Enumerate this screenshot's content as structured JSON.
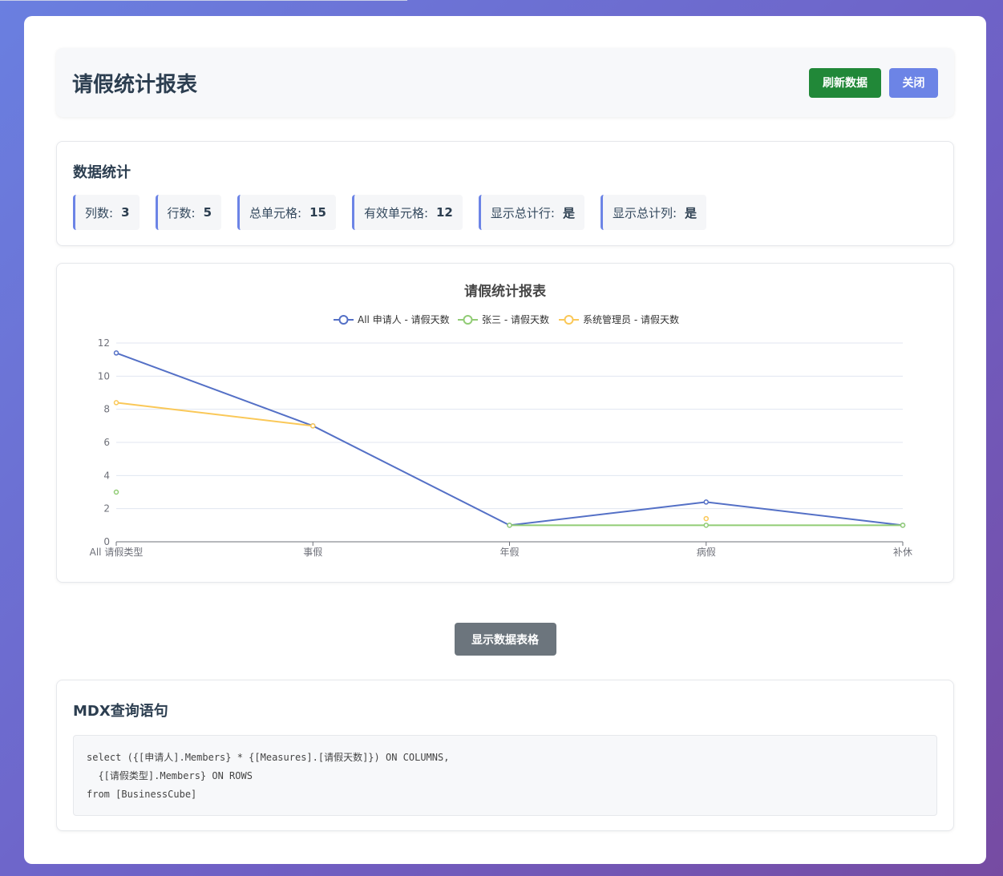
{
  "header": {
    "title": "请假统计报表",
    "refresh_label": "刷新数据",
    "close_label": "关闭"
  },
  "stats": {
    "title": "数据统计",
    "items": [
      {
        "label": "列数:",
        "value": "3"
      },
      {
        "label": "行数:",
        "value": "5"
      },
      {
        "label": "总单元格:",
        "value": "15"
      },
      {
        "label": "有效单元格:",
        "value": "12"
      },
      {
        "label": "显示总计行:",
        "value": "是"
      },
      {
        "label": "显示总计列:",
        "value": "是"
      }
    ]
  },
  "colors": {
    "accent": "#6c84e6",
    "refresh": "#218838",
    "toggle": "#6c757d"
  },
  "chart_data": {
    "type": "line",
    "title": "请假统计报表",
    "categories": [
      "All 请假类型",
      "事假",
      "年假",
      "病假",
      "补休"
    ],
    "ylim": [
      0,
      12
    ],
    "yticks": [
      0,
      2,
      4,
      6,
      8,
      10,
      12
    ],
    "grid": true,
    "legend_position": "top",
    "series": [
      {
        "name": "All 申请人 - 请假天数",
        "color": "#5470c6",
        "values": [
          11.4,
          7,
          1,
          2.4,
          1
        ]
      },
      {
        "name": "张三 - 请假天数",
        "color": "#91cc75",
        "values": [
          3,
          null,
          1,
          1,
          1
        ]
      },
      {
        "name": "系统管理员 - 请假天数",
        "color": "#fac858",
        "values": [
          8.4,
          7,
          null,
          1.4,
          null
        ]
      }
    ]
  },
  "toggle": {
    "label": "显示数据表格"
  },
  "mdx": {
    "title": "MDX查询语句",
    "code": "select ({[申请人].Members} * {[Measures].[请假天数]}) ON COLUMNS,\n  {[请假类型].Members} ON ROWS\nfrom [BusinessCube]"
  }
}
